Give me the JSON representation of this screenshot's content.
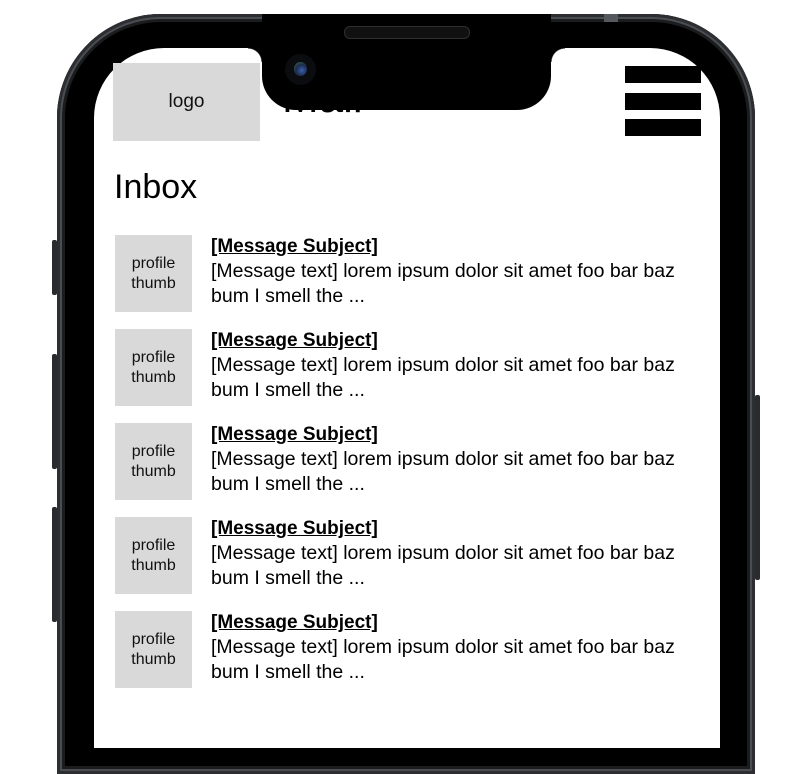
{
  "header": {
    "logo_label": "logo",
    "app_title": "Mail",
    "menu_icon": "hamburger-menu-icon"
  },
  "inbox": {
    "title": "Inbox",
    "messages": [
      {
        "thumb_label": "profile\nthumb",
        "subject": "[Message Subject]",
        "preview": "[Message text] lorem ipsum dolor sit amet foo bar baz bum I smell the ..."
      },
      {
        "thumb_label": "profile\nthumb",
        "subject": "[Message Subject]",
        "preview": "[Message text] lorem ipsum dolor sit amet foo bar baz bum I smell the ..."
      },
      {
        "thumb_label": "profile\nthumb",
        "subject": "[Message Subject]",
        "preview": "[Message text] lorem ipsum dolor sit amet foo bar baz bum I smell the ..."
      },
      {
        "thumb_label": "profile\nthumb",
        "subject": "[Message Subject]",
        "preview": "[Message text] lorem ipsum dolor sit amet foo bar baz bum I smell the ..."
      },
      {
        "thumb_label": "profile\nthumb",
        "subject": "[Message Subject]",
        "preview": "[Message text] lorem ipsum dolor sit amet foo bar baz bum I smell the ..."
      }
    ]
  },
  "colors": {
    "placeholder_fill": "#d9d9d9",
    "frame": "#000000",
    "text": "#000000"
  }
}
